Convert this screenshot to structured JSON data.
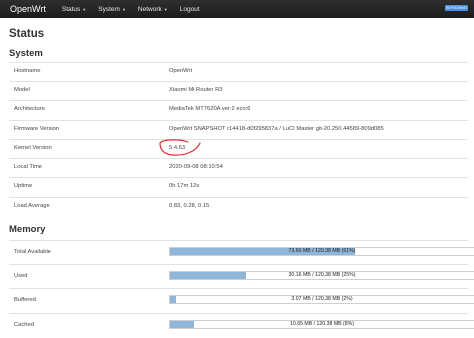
{
  "nav": {
    "brand": "OpenWrt",
    "items": [
      {
        "label": "Status",
        "dropdown": true
      },
      {
        "label": "System",
        "dropdown": true
      },
      {
        "label": "Network",
        "dropdown": true
      },
      {
        "label": "Logout",
        "dropdown": false
      }
    ],
    "refresh_badge": "REFRESHING"
  },
  "page_title": "Status",
  "system": {
    "title": "System",
    "rows": [
      {
        "label": "Hostname",
        "value": "OpenWrt"
      },
      {
        "label": "Model",
        "value": "Xiaomi Mi Router R3"
      },
      {
        "label": "Architecture",
        "value": "MediaTek MT7620A ver:2 eco:6"
      },
      {
        "label": "Firmware Version",
        "value": "OpenWrt SNAPSHOT r14418-d0f295837a / LuCI Master git-20.250.44589-809d085"
      },
      {
        "label": "Kernel Version",
        "value": "5.4.63"
      },
      {
        "label": "Local Time",
        "value": "2020-09-08 08:10:54"
      },
      {
        "label": "Uptime",
        "value": "0h 17m 12s"
      },
      {
        "label": "Load Average",
        "value": "0.83, 0.28, 0.15"
      }
    ]
  },
  "memory": {
    "title": "Memory",
    "rows": [
      {
        "label": "Total Available",
        "text": "73.60 MB / 120.38 MB (61%)",
        "fraction": 0.61
      },
      {
        "label": "Used",
        "text": "30.16 MB / 120.38 MB (25%)",
        "fraction": 0.25
      },
      {
        "label": "Buffered",
        "text": "3.07 MB / 120.38 MB (2%)",
        "fraction": 0.02
      },
      {
        "label": "Cached",
        "text": "10.65 MB / 120.38 MB (8%)",
        "fraction": 0.08
      }
    ],
    "bar_color": "#8fb5d8"
  },
  "annotation": {
    "color": "#d9302c",
    "target": "Kernel Version"
  }
}
